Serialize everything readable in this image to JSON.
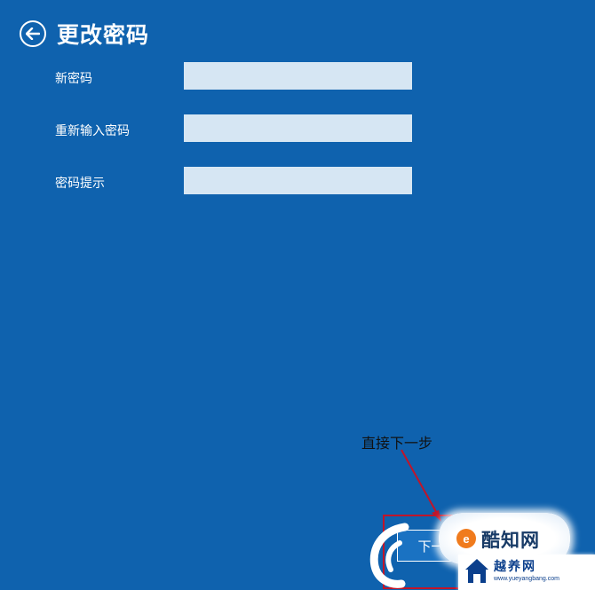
{
  "header": {
    "title": "更改密码"
  },
  "form": {
    "new_password": {
      "label": "新密码",
      "value": ""
    },
    "reenter_password": {
      "label": "重新输入密码",
      "value": ""
    },
    "password_hint": {
      "label": "密码提示",
      "value": ""
    }
  },
  "annotation": {
    "text": "直接下一步"
  },
  "footer": {
    "next_button": "下一步"
  },
  "watermark": {
    "badge_text": "酷知网",
    "badge_icon_letter": "e",
    "footer_brand": "越养网",
    "footer_url": "www.yueyangbang.com"
  },
  "colors": {
    "background": "#0f62ae",
    "field": "#d6e6f3",
    "annotation_red": "#c0152a"
  }
}
